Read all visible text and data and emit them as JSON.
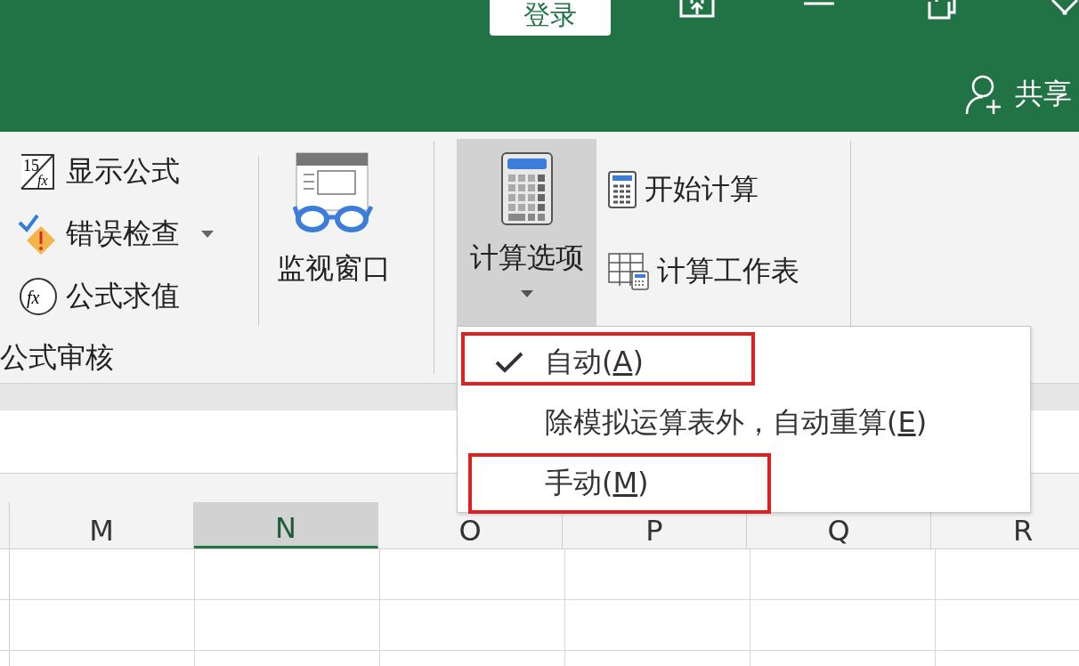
{
  "title_bar": {
    "sign_in": "登录",
    "share": "共享"
  },
  "ribbon": {
    "group": {
      "label": "公式审核",
      "items": [
        {
          "kind": "show-formulas",
          "label": "显示公式",
          "dropdown": false,
          "icon_texts": [
            "15",
            "fx"
          ]
        },
        {
          "kind": "error-check",
          "label": "错误检查",
          "dropdown": true
        },
        {
          "kind": "evaluate",
          "label": "公式求值",
          "dropdown": false,
          "icon_texts": [
            "fx"
          ]
        }
      ]
    },
    "watch_window": "监视窗口",
    "calc_options": {
      "label": "计算选项",
      "selected": true
    },
    "calc_now": "开始计算",
    "calc_sheet": "计算工作表"
  },
  "menu": {
    "items": [
      {
        "before": "自动(",
        "key": "A",
        "after": ")",
        "checked": true,
        "highlighted": true
      },
      {
        "before": "除模拟运算表外，自动重算(",
        "key": "E",
        "after": ")",
        "checked": false,
        "highlighted": false
      },
      {
        "before": "手动(",
        "key": "M",
        "after": ")",
        "checked": false,
        "highlighted": true
      }
    ]
  },
  "columns": [
    {
      "label": "M",
      "selected": false
    },
    {
      "label": "N",
      "selected": true
    },
    {
      "label": "O",
      "selected": false
    },
    {
      "label": "P",
      "selected": false
    },
    {
      "label": "Q",
      "selected": false
    },
    {
      "label": "R",
      "selected": false
    }
  ]
}
